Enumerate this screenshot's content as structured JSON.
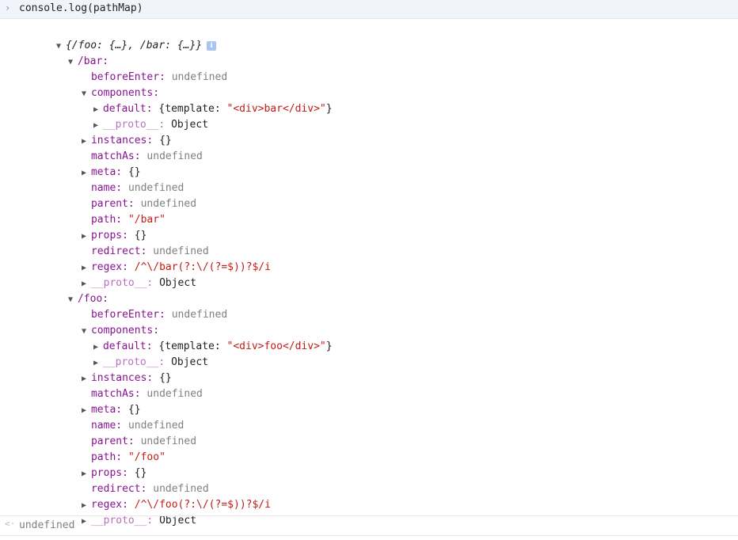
{
  "input": {
    "prompt_icon": "chevron-right-icon",
    "prompt_glyph": "›",
    "command": "console.log(pathMap)"
  },
  "result": {
    "return_icon": "return-arrow-icon",
    "return_glyph": "<·",
    "value": "undefined"
  },
  "root": {
    "summary": "{/foo: {…}, /bar: {…}}",
    "info_badge": "i"
  },
  "routes": [
    {
      "key": "/bar:",
      "beforeEnter": {
        "key": "beforeEnter:",
        "value": "undefined"
      },
      "components": {
        "key": "components:",
        "default": {
          "key": "default:",
          "pre": "{template: ",
          "str": "\"<div>bar</div>\"",
          "post": "}"
        },
        "proto": {
          "key": "__proto__:",
          "value": "Object"
        }
      },
      "instances": {
        "key": "instances:",
        "value": "{}"
      },
      "matchAs": {
        "key": "matchAs:",
        "value": "undefined"
      },
      "meta": {
        "key": "meta:",
        "value": "{}"
      },
      "name": {
        "key": "name:",
        "value": "undefined"
      },
      "parent": {
        "key": "parent:",
        "value": "undefined"
      },
      "path": {
        "key": "path:",
        "value": "\"/bar\""
      },
      "props": {
        "key": "props:",
        "value": "{}"
      },
      "redirect": {
        "key": "redirect:",
        "value": "undefined"
      },
      "regex": {
        "key": "regex:",
        "value": "/^\\/bar(?:\\/(?=$))?$/i"
      },
      "proto": {
        "key": "__proto__:",
        "value": "Object"
      }
    },
    {
      "key": "/foo:",
      "beforeEnter": {
        "key": "beforeEnter:",
        "value": "undefined"
      },
      "components": {
        "key": "components:",
        "default": {
          "key": "default:",
          "pre": "{template: ",
          "str": "\"<div>foo</div>\"",
          "post": "}"
        },
        "proto": {
          "key": "__proto__:",
          "value": "Object"
        }
      },
      "instances": {
        "key": "instances:",
        "value": "{}"
      },
      "matchAs": {
        "key": "matchAs:",
        "value": "undefined"
      },
      "meta": {
        "key": "meta:",
        "value": "{}"
      },
      "name": {
        "key": "name:",
        "value": "undefined"
      },
      "parent": {
        "key": "parent:",
        "value": "undefined"
      },
      "path": {
        "key": "path:",
        "value": "\"/foo\""
      },
      "props": {
        "key": "props:",
        "value": "{}"
      },
      "redirect": {
        "key": "redirect:",
        "value": "undefined"
      },
      "regex": {
        "key": "regex:",
        "value": "/^\\/foo(?:\\/(?=$))?$/i"
      },
      "proto": {
        "key": "__proto__:",
        "value": "Object"
      }
    }
  ],
  "glyphs": {
    "expanded": "▼",
    "collapsed": "▶"
  },
  "colors": {
    "key": "#881391",
    "string": "#c41a16",
    "undefined": "#808080",
    "input_bg": "#f1f5fb",
    "info_badge_bg": "#a8c5f0"
  }
}
